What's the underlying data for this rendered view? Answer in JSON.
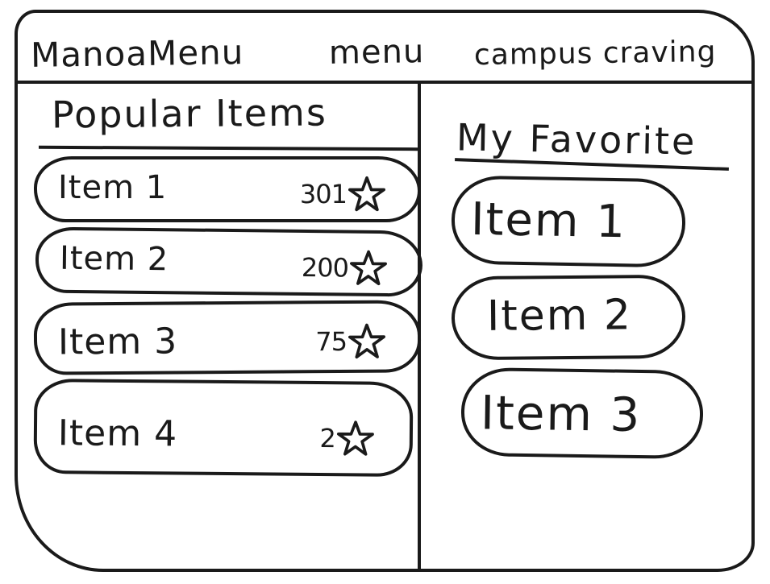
{
  "nav": {
    "brand": "ManoaMenu",
    "menu_label": "menu",
    "campus_label": "campus craving"
  },
  "popular": {
    "title": "Popular Items",
    "items": [
      {
        "name": "Item 1",
        "count": "301"
      },
      {
        "name": "Item 2",
        "count": "200"
      },
      {
        "name": "Item 3",
        "count": "75"
      },
      {
        "name": "Item 4",
        "count": "2"
      }
    ],
    "rating_icon": "star-icon"
  },
  "favorites": {
    "title": "My Favorite",
    "items": [
      {
        "name": "Item 1"
      },
      {
        "name": "Item 2"
      },
      {
        "name": "Item 3"
      }
    ]
  },
  "colors": {
    "ink": "#1a1a1a",
    "paper": "#ffffff"
  }
}
